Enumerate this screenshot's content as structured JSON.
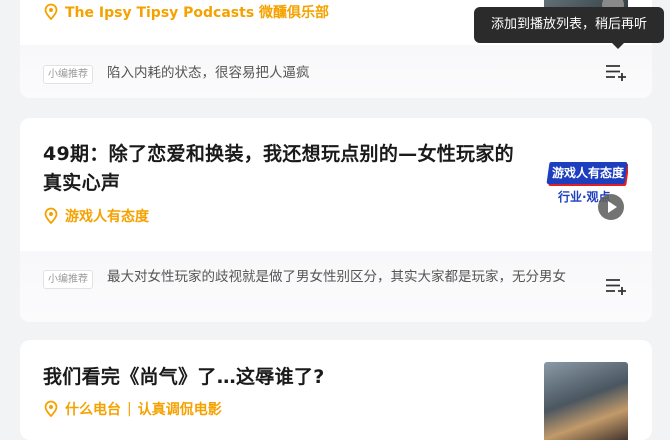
{
  "tooltip": {
    "text": "添加到播放列表，稍后再听"
  },
  "cards": [
    {
      "source": "The Ipsy Tipsy Podcasts 微醺俱乐部",
      "rec_tag": "小编推荐",
      "rec_text": "陷入内耗的状态，很容易把人逼疯"
    },
    {
      "title": "49期：除了恋爱和换装，我还想玩点别的—女性玩家的真实心声",
      "source": "游戏人有态度",
      "cover_title": "游戏人有态度",
      "cover_subtitle": "行业·观点",
      "rec_tag": "小编推荐",
      "rec_text": "最大对女性玩家的歧视就是做了男女性别区分，其实大家都是玩家，无分男女"
    },
    {
      "title": "我们看完《尚气》了…这辱谁了?",
      "source": "什么电台",
      "source2": "认真调侃电影"
    }
  ],
  "colors": {
    "accent": "#f5a200",
    "tooltip_bg": "#2b2b2b"
  },
  "icons": [
    "location-pin-icon",
    "playlist-add-icon",
    "play-icon"
  ]
}
